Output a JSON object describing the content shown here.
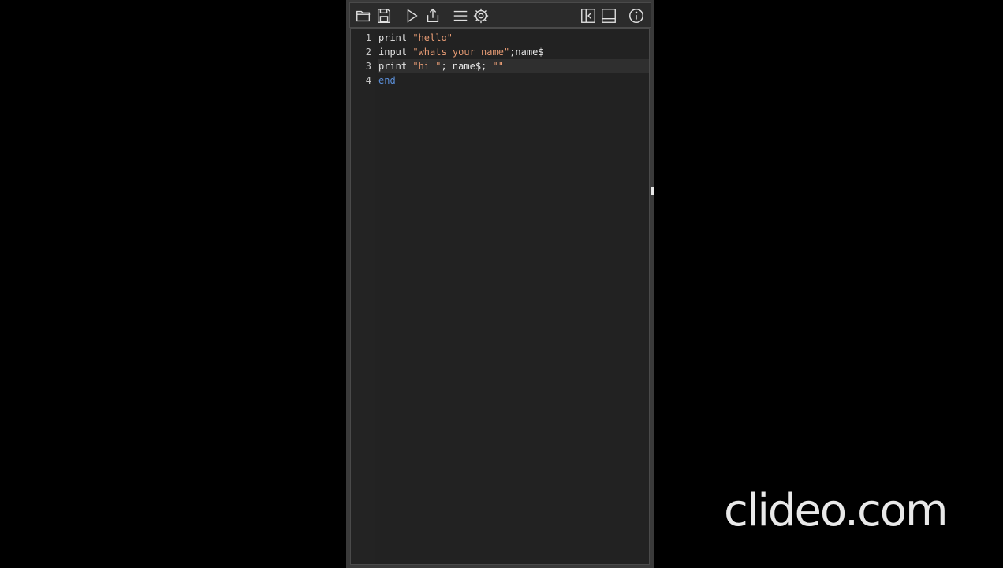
{
  "toolbar": {
    "buttons_left": [
      {
        "name": "open-folder-icon"
      },
      {
        "name": "save-icon"
      },
      {
        "name": "run-icon"
      },
      {
        "name": "share-icon"
      },
      {
        "name": "menu-icon"
      },
      {
        "name": "settings-icon"
      }
    ],
    "buttons_right": [
      {
        "name": "collapse-panel-icon"
      },
      {
        "name": "bottom-panel-icon"
      },
      {
        "name": "info-icon"
      }
    ]
  },
  "editor": {
    "lines": [
      {
        "num": "1",
        "kw": "print ",
        "str": "\"hello\"",
        "rest": ""
      },
      {
        "num": "2",
        "kw": "input ",
        "str": "\"whats your name\"",
        "rest": ";name$"
      },
      {
        "num": "3",
        "kw": "print ",
        "str": "\"hi \"",
        "rest": "; name$; ",
        "str2": "\"\""
      },
      {
        "num": "4",
        "end": "end"
      }
    ],
    "active_line": 3
  },
  "watermark": "clideo.com",
  "colors": {
    "background": "#000000",
    "editor_bg": "#222222",
    "string": "#e59a73",
    "keyword_end": "#5b8fd9",
    "text": "#e6e6e6"
  }
}
